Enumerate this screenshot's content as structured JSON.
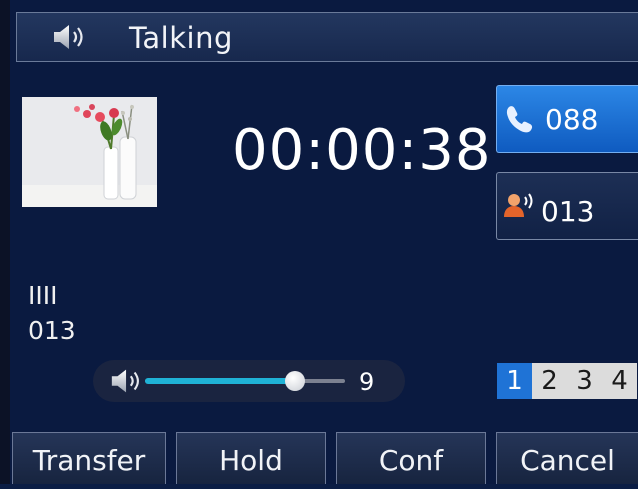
{
  "header": {
    "title": "Talking",
    "icon": "speaker-icon"
  },
  "call": {
    "timer": "00:00:38",
    "caller_name": "IIII",
    "caller_number": "013"
  },
  "lines": [
    {
      "label": "088",
      "icon": "handset-icon",
      "active": true
    },
    {
      "label": "013",
      "icon": "contact-speaking-icon",
      "active": false
    }
  ],
  "volume": {
    "level": "9",
    "fraction": 0.75,
    "icon": "speaker-icon",
    "fill_color": "#1fb2d6"
  },
  "accounts": {
    "pages": [
      "1",
      "2",
      "3",
      "4"
    ],
    "active_index": 0,
    "active_color": "#1f73d6"
  },
  "softkeys": {
    "transfer": "Transfer",
    "hold": "Hold",
    "conf": "Conf",
    "cancel": "Cancel"
  },
  "colors": {
    "background": "#0a1a40",
    "line_active": "#1f6fd8"
  }
}
